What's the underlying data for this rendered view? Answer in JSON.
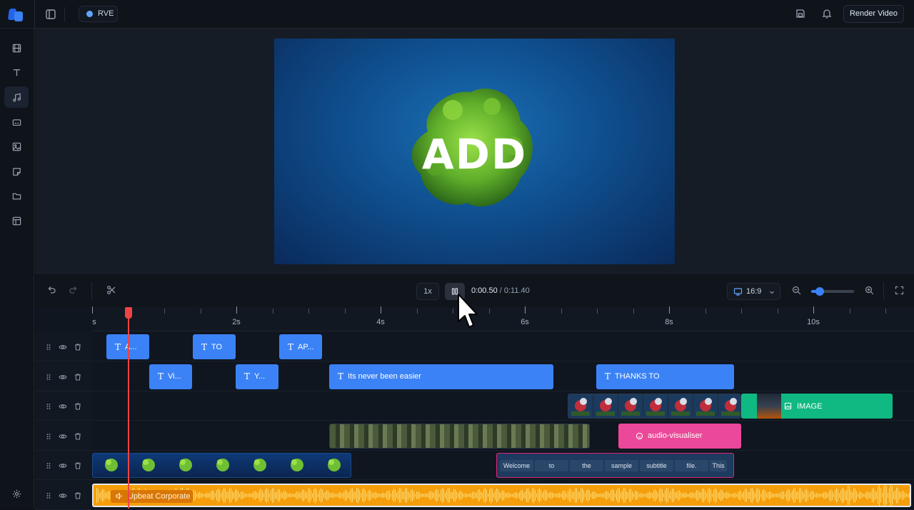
{
  "app": {
    "project_name": "RVE",
    "render_label": "Render Video"
  },
  "preview": {
    "overlay_text": "ADD"
  },
  "controls": {
    "speed": "1x",
    "current_time": "0:00.50",
    "separator": " / ",
    "total_time": "0:11.40",
    "aspect": "16:9",
    "zoom_level": 0.2
  },
  "ruler": {
    "labels": [
      "s",
      "2s",
      "4s",
      "6s",
      "8s",
      "10s"
    ]
  },
  "tracks": {
    "text1": [
      "A...",
      "TO",
      "AP..."
    ],
    "text2": [
      "Vi...",
      "Y...",
      "Its never been easier",
      "THANKS TO"
    ],
    "image_label": "IMAGE",
    "audio_visualiser_label": "audio-visualiser",
    "subtitles": [
      "Welcome",
      "to",
      "the",
      "sample",
      "subtitle",
      "file.",
      "This"
    ],
    "audio_label": "Upbeat Corporate"
  },
  "colors": {
    "text_clip": "#3b82f6",
    "image_clip": "#10b981",
    "audio_vis_clip": "#ec4899",
    "audio_clip": "#f59e0b",
    "playhead": "#ef4444"
  }
}
